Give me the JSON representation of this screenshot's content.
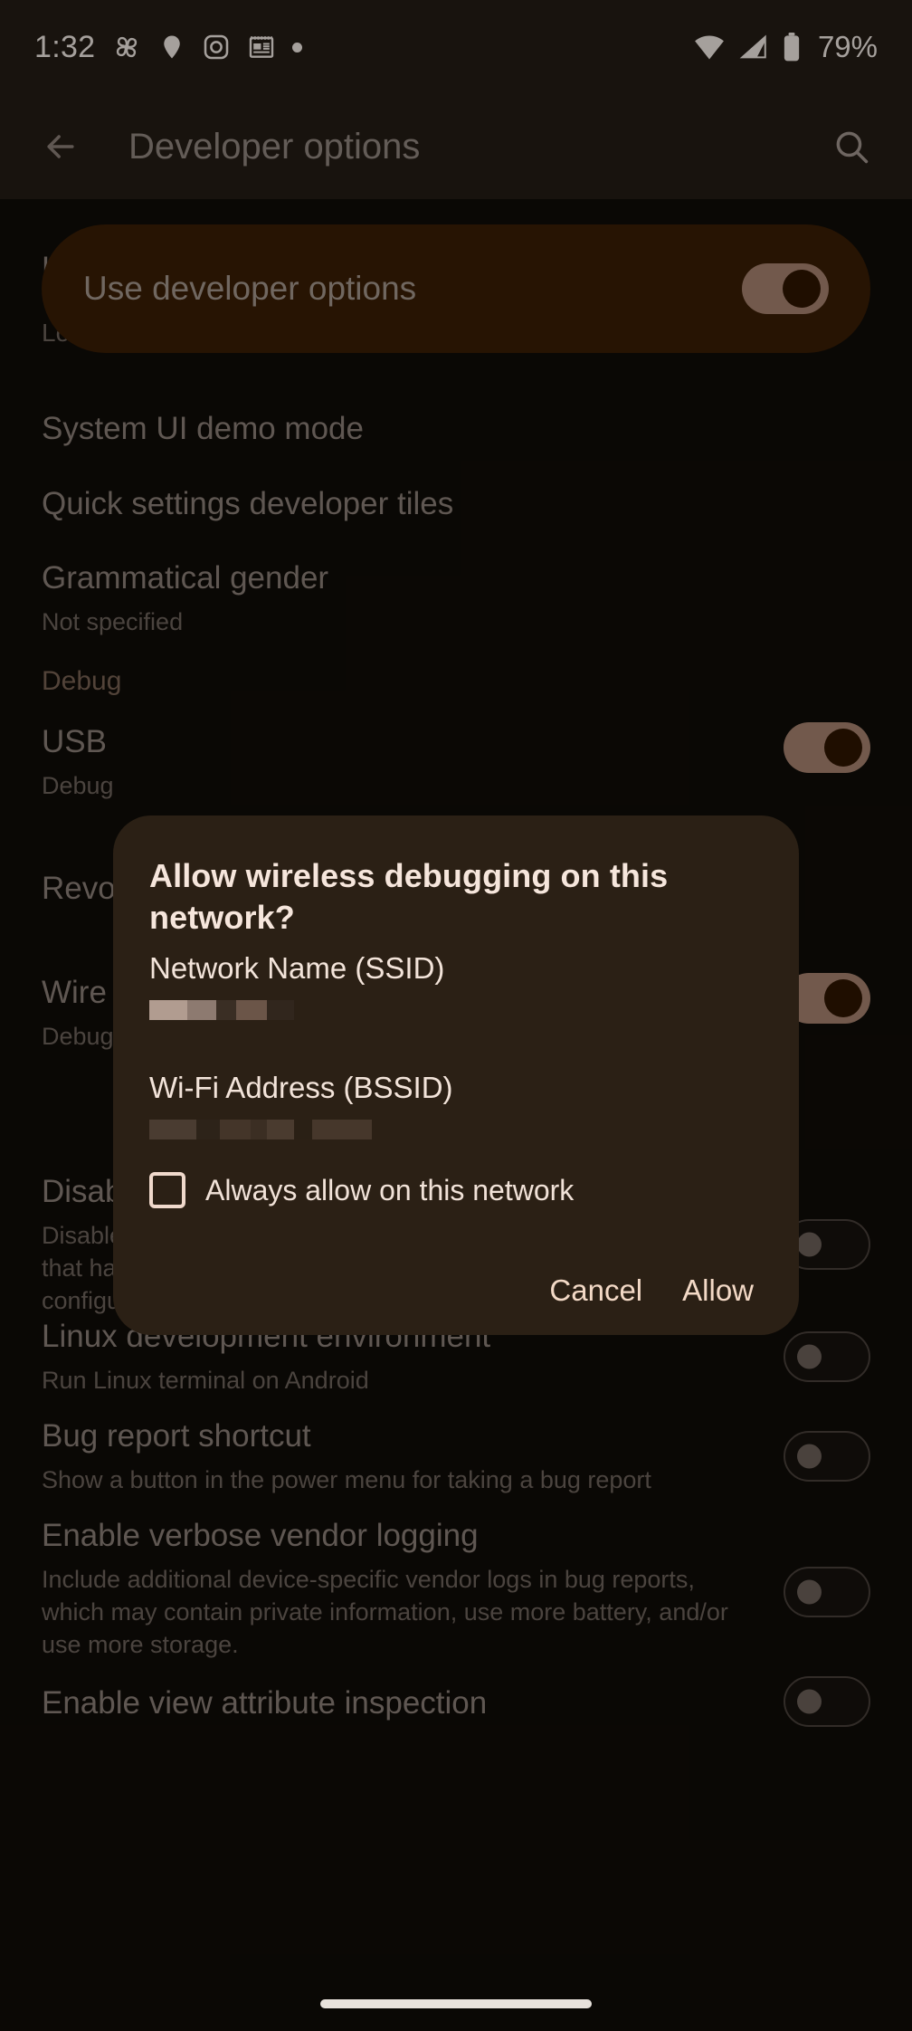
{
  "status_bar": {
    "time": "1:32",
    "battery_percent": "79%",
    "left_icons": [
      "pinwheel-icon",
      "location-pin-icon",
      "instagram-icon",
      "news-icon",
      "dot-icon"
    ],
    "right_icons": [
      "wifi-icon",
      "cellular-signal-icon",
      "battery-icon"
    ]
  },
  "app_bar": {
    "back_icon": "arrow-back-icon",
    "title": "Developer options",
    "search_icon": "search-icon"
  },
  "banner": {
    "label": "Use developer options",
    "toggle_state": "on"
  },
  "list_items": [
    {
      "title": "Load a Dynamic System Update Image",
      "sub": "",
      "control": "none",
      "partial": true
    },
    {
      "title": "System UI demo mode",
      "sub": "",
      "control": "none"
    },
    {
      "title": "Quick settings developer tiles",
      "sub": "",
      "control": "none"
    },
    {
      "title": "Grammatical gender",
      "sub": "Not specified",
      "control": "none"
    },
    {
      "title": "Debug",
      "sub": "",
      "control": "section-header"
    },
    {
      "title": "USB",
      "sub": "Debug",
      "control": "toggle-on",
      "clipped": true
    },
    {
      "title": "Revo",
      "sub": "",
      "control": "none",
      "clipped": true
    },
    {
      "title": "Wire",
      "sub": "Debug",
      "control": "toggle-on",
      "clipped": true
    },
    {
      "title": "Disable adb authorization timeout",
      "sub": "Disable automatic revocation of adb authorizations for systems that have not reconnected within the default (7 days) or user-configured (minimum 1 day) amount of time.",
      "control": "toggle-off"
    },
    {
      "title": "Linux development environment",
      "sub": "Run Linux terminal on Android",
      "control": "toggle-off"
    },
    {
      "title": "Bug report shortcut",
      "sub": "Show a button in the power menu for taking a bug report",
      "control": "toggle-off"
    },
    {
      "title": "Enable verbose vendor logging",
      "sub": "Include additional device-specific vendor logs in bug reports, which may contain private information, use more battery, and/or use more storage.",
      "control": "toggle-off"
    },
    {
      "title": "Enable view attribute inspection",
      "sub": "",
      "control": "toggle-off"
    }
  ],
  "dialog": {
    "title": "Allow wireless debugging on this network?",
    "ssid_label": "Network Name (SSID)",
    "ssid_value": "",
    "bssid_label": "Wi-Fi Address (BSSID)",
    "bssid_value": "",
    "checkbox_label": "Always allow on this network",
    "checkbox_checked": false,
    "cancel_label": "Cancel",
    "allow_label": "Allow"
  },
  "nav_bar": {
    "gesture_pill": "home-gesture-pill"
  },
  "colors": {
    "background": "#100c08",
    "surface_bar": "#241c16",
    "dialog_surface": "#2b2015",
    "banner": "#3a1e05",
    "accent_toggle": "#a88471",
    "title_text": "#8d8179",
    "sub_text": "#6f655e",
    "dialog_text": "#f3e4da",
    "button_text": "#f3d9c6"
  }
}
